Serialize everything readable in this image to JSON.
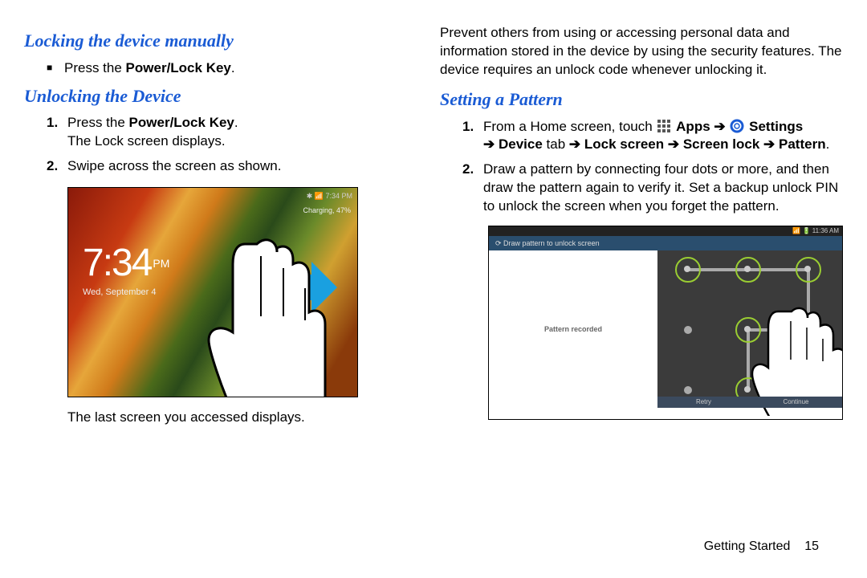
{
  "left": {
    "heading_lock": "Locking the device manually",
    "bullet_lock_pre": "Press the ",
    "bullet_lock_bold": "Power/Lock Key",
    "bullet_lock_post": ".",
    "heading_unlock": "Unlocking the Device",
    "step1_pre": "Press the ",
    "step1_bold": "Power/Lock Key",
    "step1_post": ".",
    "step1_line2": "The Lock screen displays.",
    "step2": "Swipe across the screen as shown.",
    "num1": "1.",
    "num2": "2.",
    "caption": "The last screen you accessed displays.",
    "lock_time": "7:34",
    "lock_ampm": "PM",
    "lock_date": "Wed, September 4",
    "sbar1": "✱ 📶 7:34 PM",
    "sbar2": "Charging, 47%"
  },
  "right": {
    "intro": "Prevent others from using or accessing personal data and information stored in the device by using the security features. The device requires an unlock code whenever unlocking it.",
    "heading_pattern": "Setting a Pattern",
    "num1": "1.",
    "step1_a": "From a Home screen, touch ",
    "step1_apps": " Apps ",
    "step1_settings": " Settings",
    "step1_b": " ",
    "step1_c": "Device",
    "step1_d": " tab ",
    "step1_e": "Lock screen",
    "step1_f": "Screen lock",
    "step1_g": "Pattern",
    "num2": "2.",
    "step2": "Draw a pattern by connecting four dots or more, and then draw the pattern again to verify it. Set a backup unlock PIN to unlock the screen when you forget the pattern.",
    "ss2_status": "📶 🔋 11:36 AM",
    "ss2_banner": "⟳ Draw pattern to unlock screen",
    "ss2_recorded": "Pattern recorded",
    "ss2_retry": "Retry",
    "ss2_cont": "Continue",
    "arrow": "➔"
  },
  "footer": {
    "section": "Getting Started",
    "page": "15"
  }
}
